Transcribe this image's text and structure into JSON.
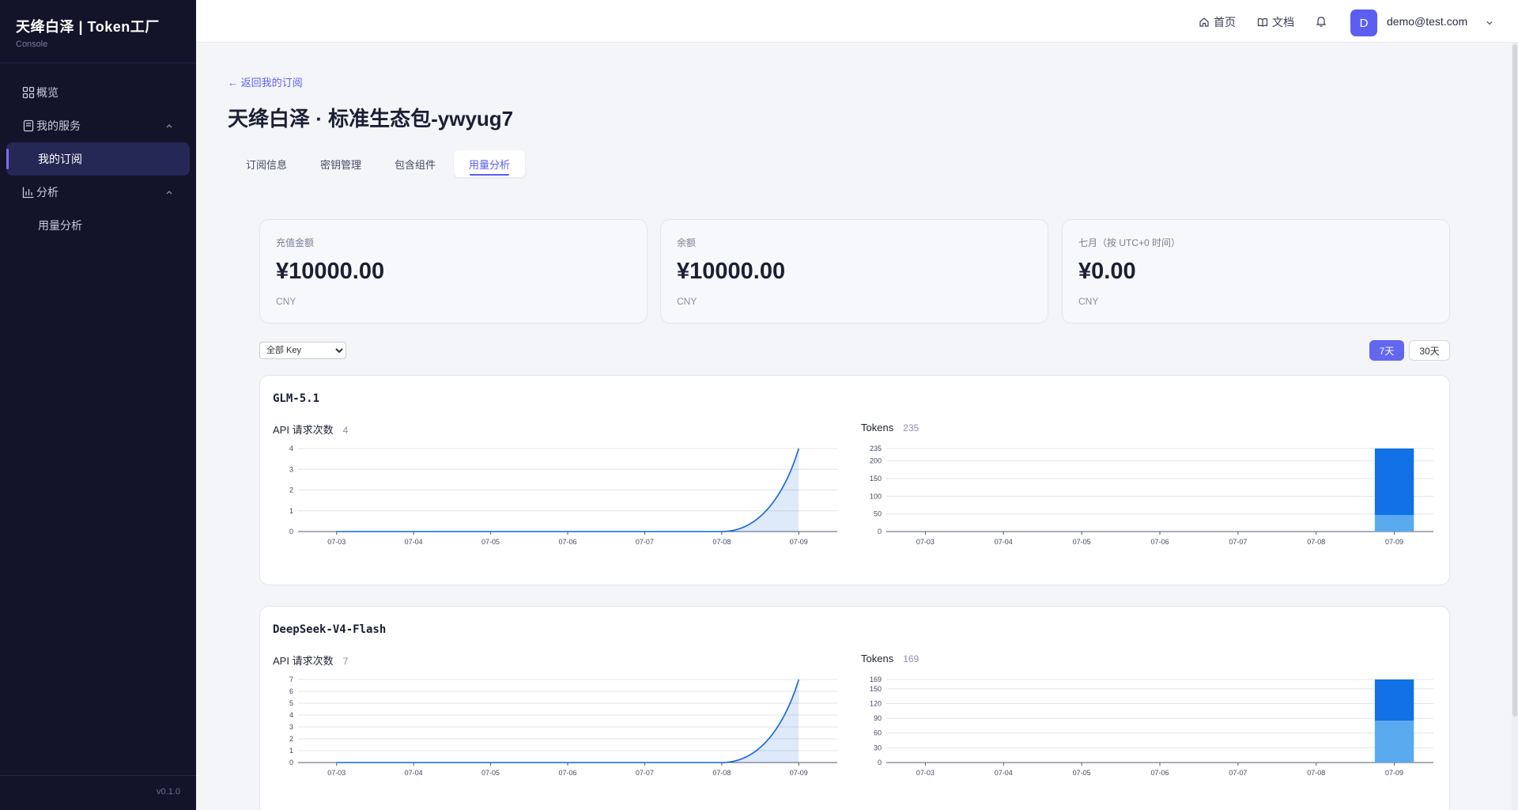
{
  "sidebar": {
    "brand_title": "天绛白泽 | Token工厂",
    "brand_sub": "Console",
    "overview": "概览",
    "my_services": "我的服务",
    "my_subscriptions": "我的订阅",
    "analytics": "分析",
    "usage_analysis": "用量分析",
    "version": "v0.1.0"
  },
  "topbar": {
    "home": "首页",
    "docs": "文档",
    "avatar_letter": "D",
    "email": "demo@test.com"
  },
  "main": {
    "back": "← 返回我的订阅",
    "title": "天绛白泽 · 标准生态包-ywyug7",
    "tabs": [
      "订阅信息",
      "密钥管理",
      "包含组件",
      "用量分析"
    ],
    "active_tab": "用量分析",
    "stats": [
      {
        "label": "充值金额",
        "value": "¥10000.00",
        "unit": "CNY"
      },
      {
        "label": "余额",
        "value": "¥10000.00",
        "unit": "CNY"
      },
      {
        "label": "七月（按 UTC+0 时间）",
        "value": "¥0.00",
        "unit": "CNY"
      }
    ],
    "key_filter": {
      "selected": "全部 Key"
    },
    "range": {
      "options": [
        "7天",
        "30天"
      ],
      "active": "7天"
    }
  },
  "colors": {
    "accent": "#5b5ef0",
    "line": "#1565d8",
    "bar_dark": "#1271e6",
    "bar_light": "#5aaaf0"
  },
  "chart_data": [
    {
      "model": "GLM-5.1",
      "type": "area",
      "title": "API 请求次数",
      "total": "4",
      "x": [
        "07-03",
        "07-04",
        "07-05",
        "07-06",
        "07-07",
        "07-08",
        "07-09"
      ],
      "values": [
        0,
        0,
        0,
        0,
        0,
        0,
        4
      ],
      "yticks": [
        0,
        1,
        2,
        3,
        4
      ],
      "ylim": [
        0,
        4
      ],
      "grid": true
    },
    {
      "model": "GLM-5.1",
      "type": "bar",
      "stacked": true,
      "title": "Tokens",
      "total": "235",
      "x": [
        "07-03",
        "07-04",
        "07-05",
        "07-06",
        "07-07",
        "07-08",
        "07-09"
      ],
      "series": [
        {
          "values": [
            0,
            0,
            0,
            0,
            0,
            0,
            47
          ]
        },
        {
          "values": [
            0,
            0,
            0,
            0,
            0,
            0,
            188
          ]
        }
      ],
      "yticks": [
        0,
        50,
        100,
        150,
        200,
        235
      ],
      "ylim": [
        0,
        235
      ],
      "grid": true
    },
    {
      "model": "DeepSeek-V4-Flash",
      "type": "area",
      "title": "API 请求次数",
      "total": "7",
      "x": [
        "07-03",
        "07-04",
        "07-05",
        "07-06",
        "07-07",
        "07-08",
        "07-09"
      ],
      "values": [
        0,
        0,
        0,
        0,
        0,
        0,
        7
      ],
      "yticks": [
        0,
        1,
        2,
        3,
        4,
        5,
        6,
        7
      ],
      "ylim": [
        0,
        7
      ],
      "grid": true
    },
    {
      "model": "DeepSeek-V4-Flash",
      "type": "bar",
      "stacked": true,
      "title": "Tokens",
      "total": "169",
      "x": [
        "07-03",
        "07-04",
        "07-05",
        "07-06",
        "07-07",
        "07-08",
        "07-09"
      ],
      "series": [
        {
          "values": [
            0,
            0,
            0,
            0,
            0,
            0,
            85
          ]
        },
        {
          "values": [
            0,
            0,
            0,
            0,
            0,
            0,
            84
          ]
        }
      ],
      "yticks": [
        0,
        30,
        60,
        90,
        120,
        150,
        169
      ],
      "ylim": [
        0,
        169
      ],
      "grid": true
    }
  ]
}
